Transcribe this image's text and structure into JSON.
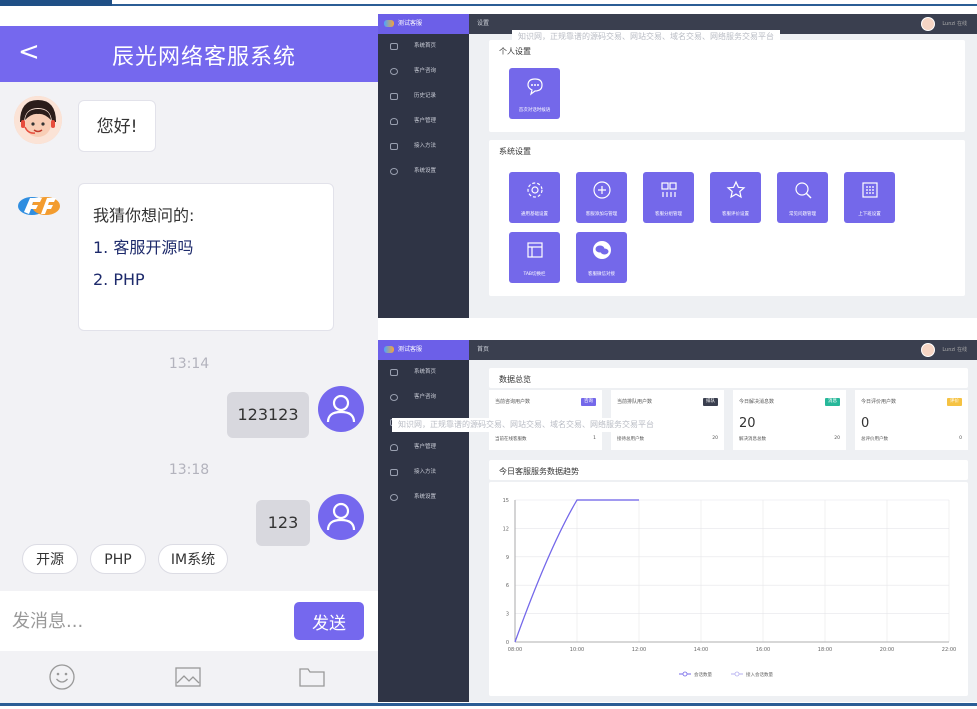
{
  "mobile": {
    "title": "辰光网络客服系统",
    "back": "<",
    "greeting": "您好!",
    "guess": {
      "heading": "我猜你想问的:",
      "items": [
        "1. 客服开源吗",
        "2. PHP"
      ]
    },
    "messages": [
      {
        "time": "13:14",
        "text": "123123"
      },
      {
        "time": "13:18",
        "text": "123"
      }
    ],
    "quick_replies": [
      "开源",
      "PHP",
      "IM系统"
    ],
    "input_placeholder": "发消息...",
    "send_label": "发送"
  },
  "admin": {
    "brand": "测试客服",
    "menu": [
      "系统首页",
      "客户咨询",
      "历史记录",
      "客户管理",
      "接入方法",
      "系统设置"
    ],
    "user": "Lunzi 在线",
    "watermark": "知识网，正规靠谱的源码交易、网站交易、域名交易、网络服务交易平台",
    "settings": {
      "breadcrumb": "设置",
      "personal_title": "个人设置",
      "personal_tiles": [
        "首次对话时候语"
      ],
      "system_title": "系统设置",
      "system_tiles": [
        "通用基础设置",
        "客服添加与管理",
        "客服分组管理",
        "客服评价设置",
        "常见问题管理",
        "上下班设置",
        "TAB切换栏",
        "客服微信对接"
      ]
    },
    "dashboard": {
      "breadcrumb": "首页",
      "overview_title": "数据总览",
      "stats": [
        {
          "label": "当前咨询用户数",
          "tag": "咨询",
          "tag_color": "#7468ea",
          "value": "",
          "sub": "当前在线客服数",
          "sub_value": "1"
        },
        {
          "label": "当前排队用户数",
          "tag": "排队",
          "tag_color": "#3a3f4f",
          "value": "",
          "sub": "接待总用户数",
          "sub_value": "20"
        },
        {
          "label": "今日解决消息数",
          "tag": "消息",
          "tag_color": "#27b89a",
          "value": "20",
          "sub": "解决消息总数",
          "sub_value": "20"
        },
        {
          "label": "今日评价用户数",
          "tag": "评价",
          "tag_color": "#f5c242",
          "value": "0",
          "sub": "总评价用户数",
          "sub_value": "0"
        }
      ],
      "trend_title": "今日客服服务数据趋势"
    }
  },
  "chart_data": {
    "type": "line",
    "title": "今日客服服务数据趋势",
    "x": [
      "08:00",
      "10:00",
      "12:00",
      "14:00",
      "16:00",
      "18:00",
      "20:00",
      "22:00"
    ],
    "yticks": [
      0,
      3,
      6,
      9,
      12,
      15
    ],
    "ylim": [
      0,
      15
    ],
    "series": [
      {
        "name": "会话数量",
        "color": "#7468ea",
        "points": [
          [
            0,
            0
          ],
          [
            0.5,
            7
          ],
          [
            1,
            15
          ],
          [
            2,
            15
          ]
        ]
      },
      {
        "name": "接入会话数量",
        "color": "#b6b0f0",
        "points": [
          [
            0,
            0
          ],
          [
            0.5,
            7
          ],
          [
            1,
            15
          ],
          [
            2,
            15
          ]
        ]
      }
    ],
    "legend": "bottom"
  }
}
